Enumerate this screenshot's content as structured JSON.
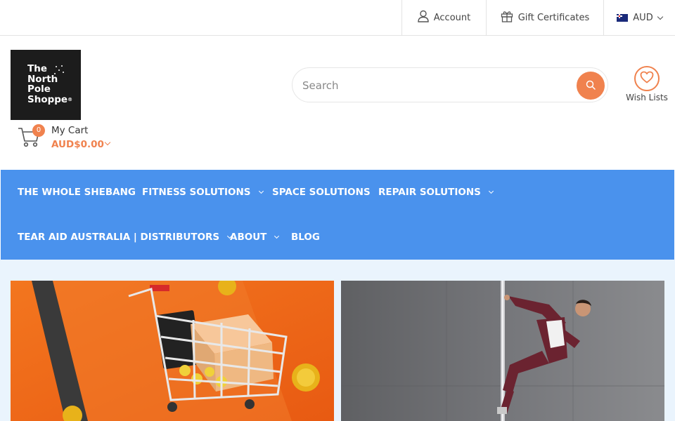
{
  "topbar": {
    "account_label": "Account",
    "gift_label": "Gift Certificates",
    "currency_label": "AUD"
  },
  "logo": {
    "line1": "The",
    "line2": "North",
    "line3": "Pole",
    "line4": "Shoppe",
    "reg": "®"
  },
  "cart": {
    "count": "0",
    "label": "My Cart",
    "total": "AUD$0.00"
  },
  "search": {
    "placeholder": "Search"
  },
  "wishlist": {
    "label": "Wish Lists"
  },
  "nav": {
    "items": [
      {
        "label": "THE WHOLE SHEBANG"
      },
      {
        "label": "FITNESS SOLUTIONS"
      },
      {
        "label": "SPACE SOLUTIONS"
      },
      {
        "label": "REPAIR SOLUTIONS"
      },
      {
        "label": "TEAR AID AUSTRALIA | DISTRIBUTORS"
      },
      {
        "label": "ABOUT"
      },
      {
        "label": "BLOG"
      }
    ]
  },
  "colors": {
    "accent": "#f0824e",
    "nav_bg": "#4a92ed",
    "content_bg": "#eaf4fd"
  },
  "icons": {
    "account": "user-icon",
    "gift": "gift-icon",
    "cart": "shopping-cart-icon",
    "search": "search-icon",
    "wishlist": "heart-icon"
  }
}
